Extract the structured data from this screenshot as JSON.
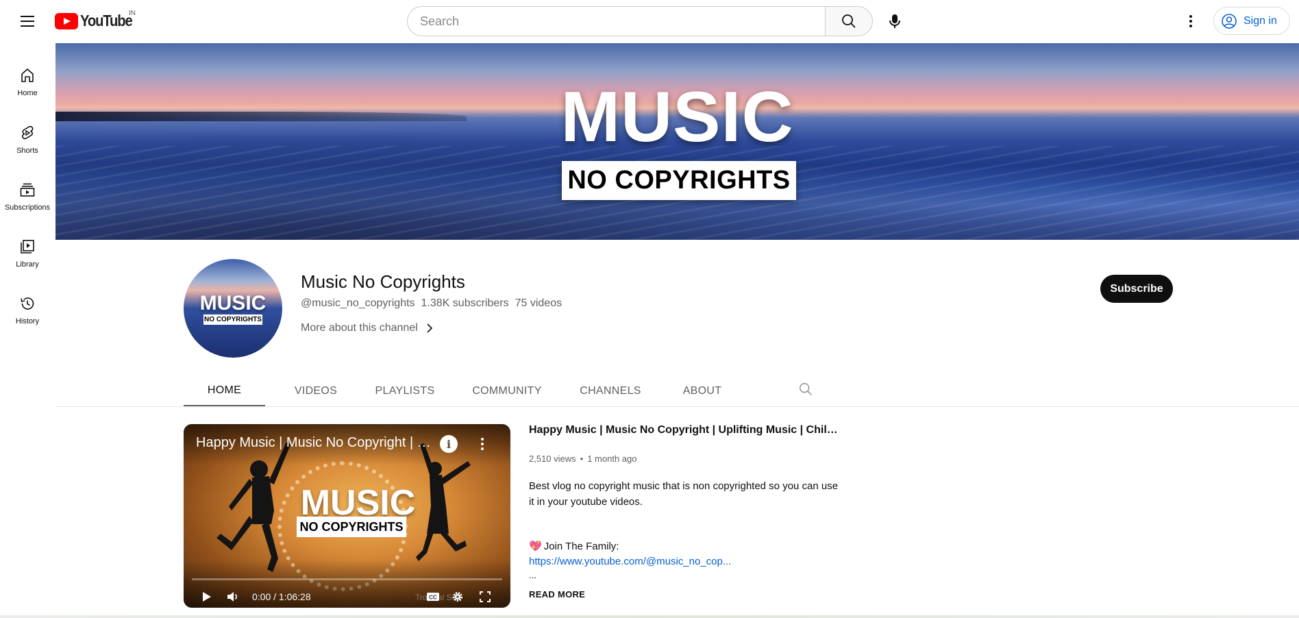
{
  "header": {
    "logo_text": "YouTube",
    "region": "IN",
    "search_placeholder": "Search",
    "sign_in": "Sign in"
  },
  "sidebar": {
    "items": [
      {
        "label": "Home",
        "icon": "home-icon"
      },
      {
        "label": "Shorts",
        "icon": "shorts-icon"
      },
      {
        "label": "Subscriptions",
        "icon": "subscriptions-icon"
      },
      {
        "label": "Library",
        "icon": "library-icon"
      },
      {
        "label": "History",
        "icon": "history-icon"
      }
    ]
  },
  "banner": {
    "title": "MUSIC",
    "subtitle": "NO COPYRIGHTS"
  },
  "channel": {
    "avatar_title": "MUSIC",
    "avatar_sub": "NO COPYRIGHTS",
    "name": "Music No Copyrights",
    "handle": "@music_no_copyrights",
    "subscribers": "1.38K subscribers",
    "videos": "75 videos",
    "more_about": "More about this channel",
    "subscribe_label": "Subscribe"
  },
  "tabs": [
    {
      "label": "HOME",
      "active": true
    },
    {
      "label": "VIDEOS",
      "active": false
    },
    {
      "label": "PLAYLISTS",
      "active": false
    },
    {
      "label": "COMMUNITY",
      "active": false
    },
    {
      "label": "CHANNELS",
      "active": false
    },
    {
      "label": "ABOUT",
      "active": false
    }
  ],
  "featured": {
    "player_title": "Happy Music | Music No Copyright | Uplifting Music | Chill Music",
    "thumb_title": "MUSIC",
    "thumb_sub": "NO COPYRIGHTS",
    "time": "0:00 / 1:06:28",
    "watermark": "Tropical Sun",
    "title": "Happy Music | Music No Copyright | Uplifting Music | Chill Music",
    "views": "2,510 views",
    "separator": "•",
    "age": "1 month ago",
    "description": "Best vlog no copyright music that is non copyrighted so you can use it in your youtube videos.",
    "join_emoji": "💖",
    "join": "Join The Family:",
    "link": "https://www.youtube.com/@music_no_cop...",
    "ellipsis": "...",
    "read_more": "READ MORE"
  },
  "colors": {
    "brand_red": "#ff0000",
    "link_blue": "#065fd4",
    "text_primary": "#0f0f0f",
    "text_secondary": "#606060"
  }
}
